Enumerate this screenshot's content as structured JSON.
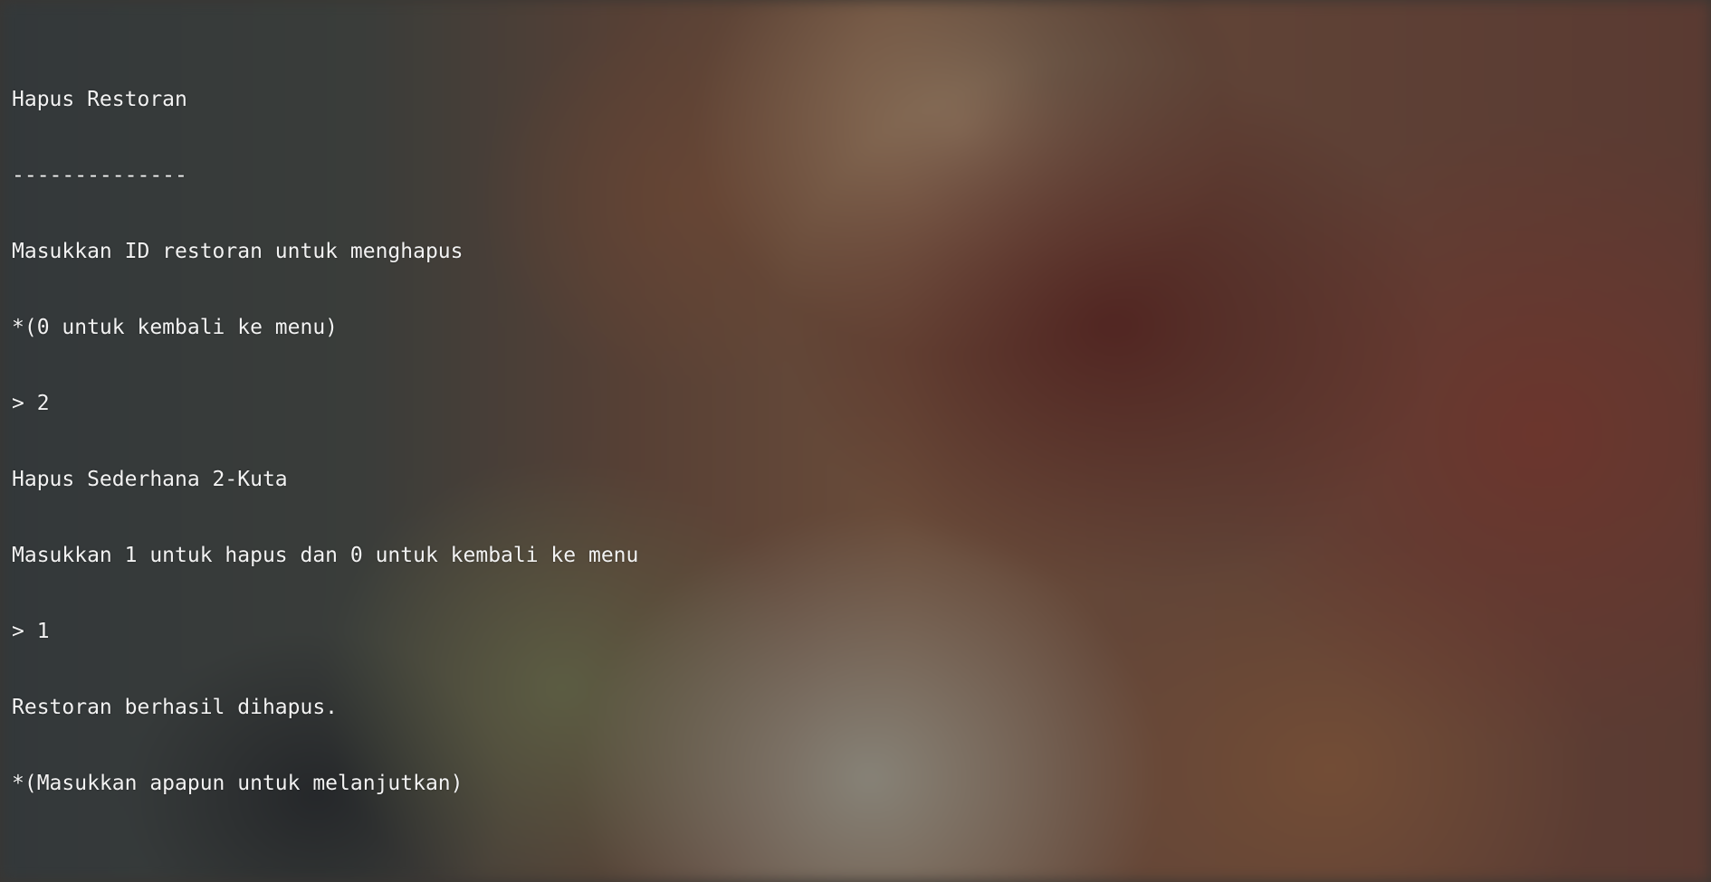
{
  "terminal": {
    "lines": [
      "Hapus Restoran",
      "--------------",
      "Masukkan ID restoran untuk menghapus",
      "*(0 untuk kembali ke menu)",
      "> 2",
      "Hapus Sederhana 2-Kuta",
      "Masukkan 1 untuk hapus dan 0 untuk kembali ke menu",
      "> 1",
      "Restoran berhasil dihapus.",
      "*(Masukkan apapun untuk melanjutkan)"
    ]
  },
  "colors": {
    "text": "#f2f2f2"
  }
}
